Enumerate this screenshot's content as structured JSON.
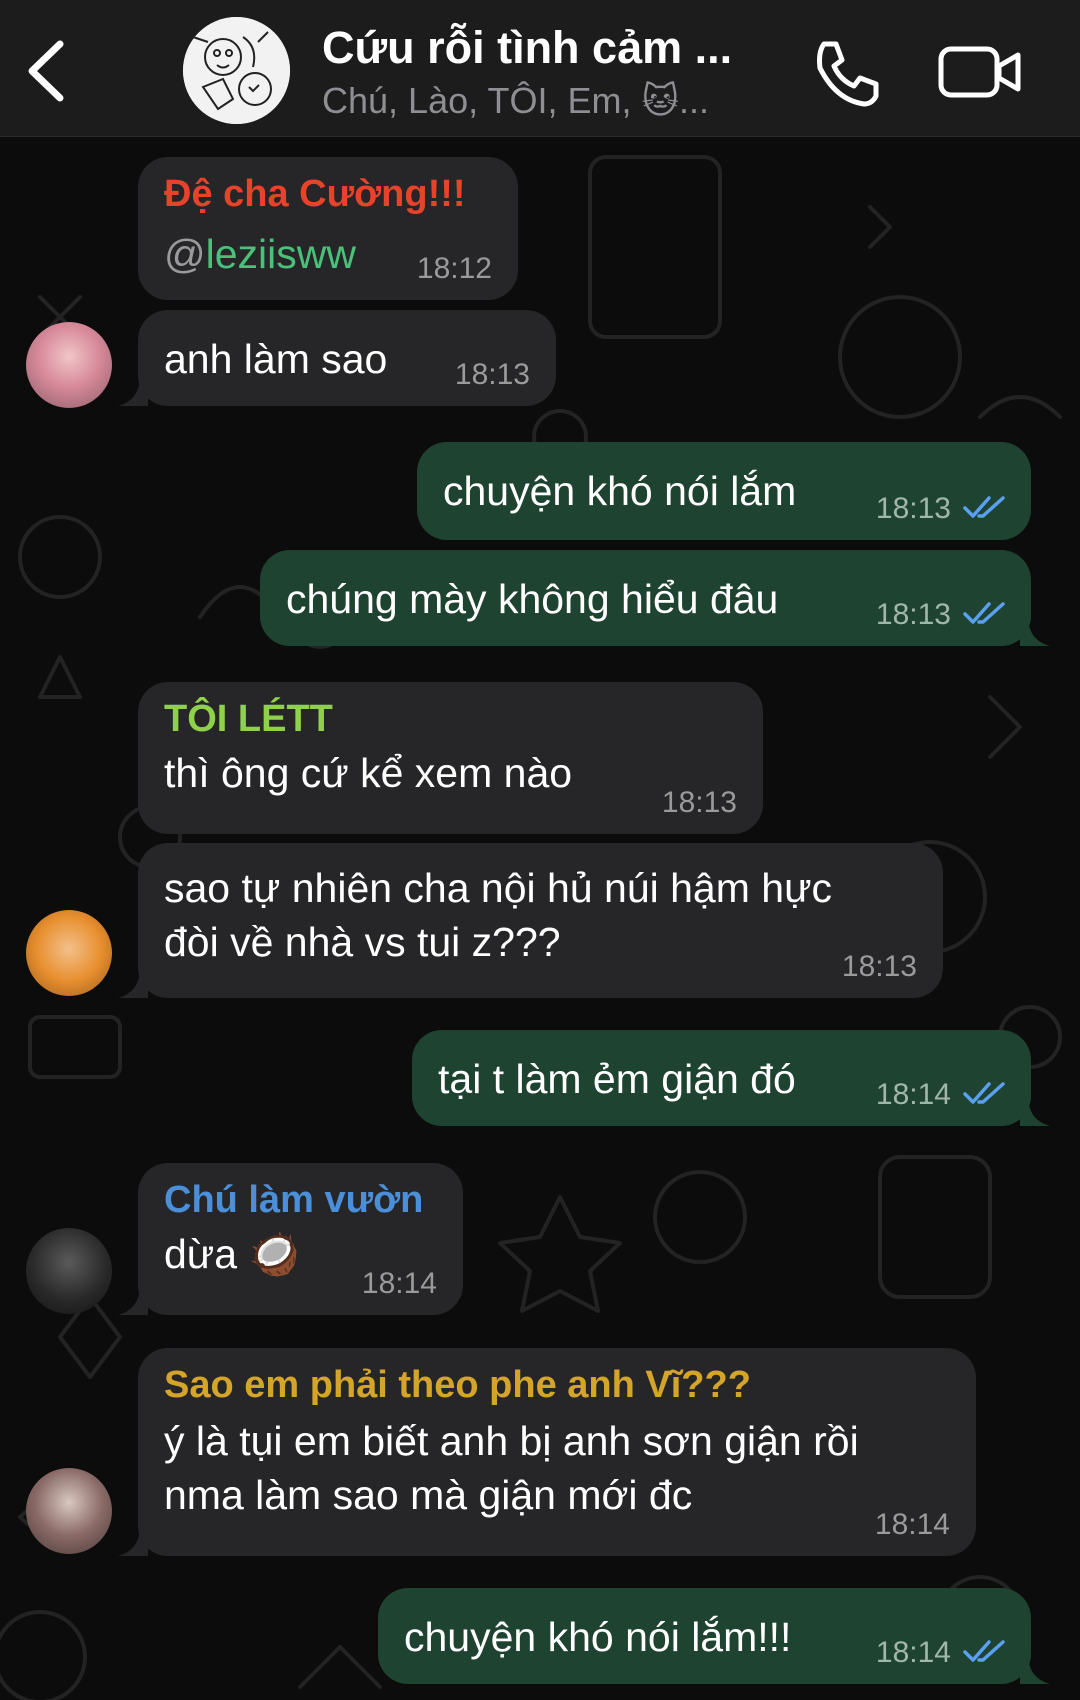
{
  "header": {
    "title": "Cứu rỗi tình cảm ...",
    "subtitle": "Chú, Lào, TÔI, Em, 🐱..."
  },
  "messages": [
    {
      "sender": "Đệ cha Cường!!!",
      "sender_color": "#e8432a",
      "at": "@",
      "mention": "leziisww",
      "time": "18:12"
    },
    {
      "text": "anh làm sao",
      "time": "18:13"
    },
    {
      "text": "chuyện khó nói lắm",
      "time": "18:13"
    },
    {
      "text": "chúng mày không hiểu đâu",
      "time": "18:13"
    },
    {
      "sender": "TÔI LÉTT",
      "sender_color": "#8fd14a",
      "text": "thì ông cứ kể xem nào",
      "time": "18:13"
    },
    {
      "text_line1": "sao tự nhiên cha nội hủ núi hậm hực",
      "text_line2": "đòi về nhà vs tui z???",
      "time": "18:13"
    },
    {
      "text": "tại t làm ẻm giận đó",
      "time": "18:14"
    },
    {
      "sender": "Chú làm vườn",
      "sender_color": "#4a8fd8",
      "text": "dừa 🥥",
      "time": "18:14"
    },
    {
      "sender": "Sao em phải theo phe anh Vĩ???",
      "sender_color": "#d4a52a",
      "text_line1": "ý là tụi em biết anh bị anh sơn giận rồi",
      "text_line2": "nma làm sao mà giận mới đc",
      "time": "18:14"
    },
    {
      "text": "chuyện khó nói lắm!!!",
      "time": "18:14"
    }
  ],
  "colors": {
    "incoming": "#262628",
    "outgoing": "#1f4331",
    "read_ticks": "#5aa0f0",
    "header_bg": "#1c1c1d"
  }
}
